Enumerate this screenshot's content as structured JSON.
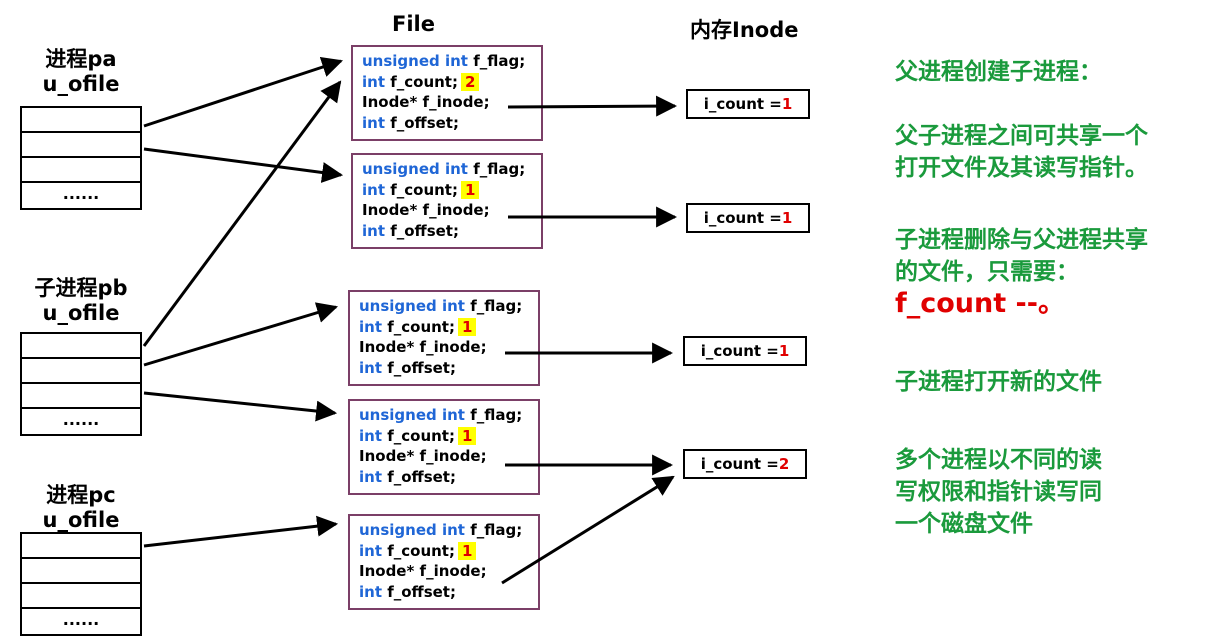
{
  "headers": {
    "file": "File",
    "inode": "内存Inode"
  },
  "processes": [
    {
      "name": "进程pa",
      "table": "u_ofile",
      "rows": [
        "",
        "",
        "",
        "......"
      ]
    },
    {
      "name": "子进程pb",
      "table": "u_ofile",
      "rows": [
        "",
        "",
        "",
        "......"
      ]
    },
    {
      "name": "进程pc",
      "table": "u_ofile",
      "rows": [
        "",
        "",
        "",
        "......"
      ]
    }
  ],
  "file_struct": {
    "kw_unsigned": "unsigned int",
    "flag": " f_flag;",
    "kw_int": "int",
    "count": " f_count;",
    "inode": "Inode* f_inode;",
    "offset": " f_offset;"
  },
  "files": [
    {
      "count_value": "2"
    },
    {
      "count_value": "1"
    },
    {
      "count_value": "1"
    },
    {
      "count_value": "1"
    },
    {
      "count_value": "1"
    }
  ],
  "inodes": [
    {
      "label": "i_count =",
      "value": "1"
    },
    {
      "label": "i_count =",
      "value": "1"
    },
    {
      "label": "i_count =",
      "value": "1"
    },
    {
      "label": "i_count =",
      "value": "2"
    }
  ],
  "notes": {
    "n1": "父进程创建子进程：",
    "n2a": "父子进程之间可共享一个",
    "n2b": "打开文件及其读写指针。",
    "n3a": "子进程删除与父进程共享",
    "n3b": "的文件，只需要：",
    "n3c": "f_count --。",
    "n4": "子进程打开新的文件",
    "n5a": "多个进程以不同的读",
    "n5b": "写权限和指针读写同",
    "n5c": "一个磁盘文件"
  },
  "colors": {
    "keyword": "#1f66d6",
    "note": "#1a9a3c",
    "highlight_bg": "#ffff00",
    "value_red": "#e00000",
    "box_border": "#7b3f67"
  }
}
